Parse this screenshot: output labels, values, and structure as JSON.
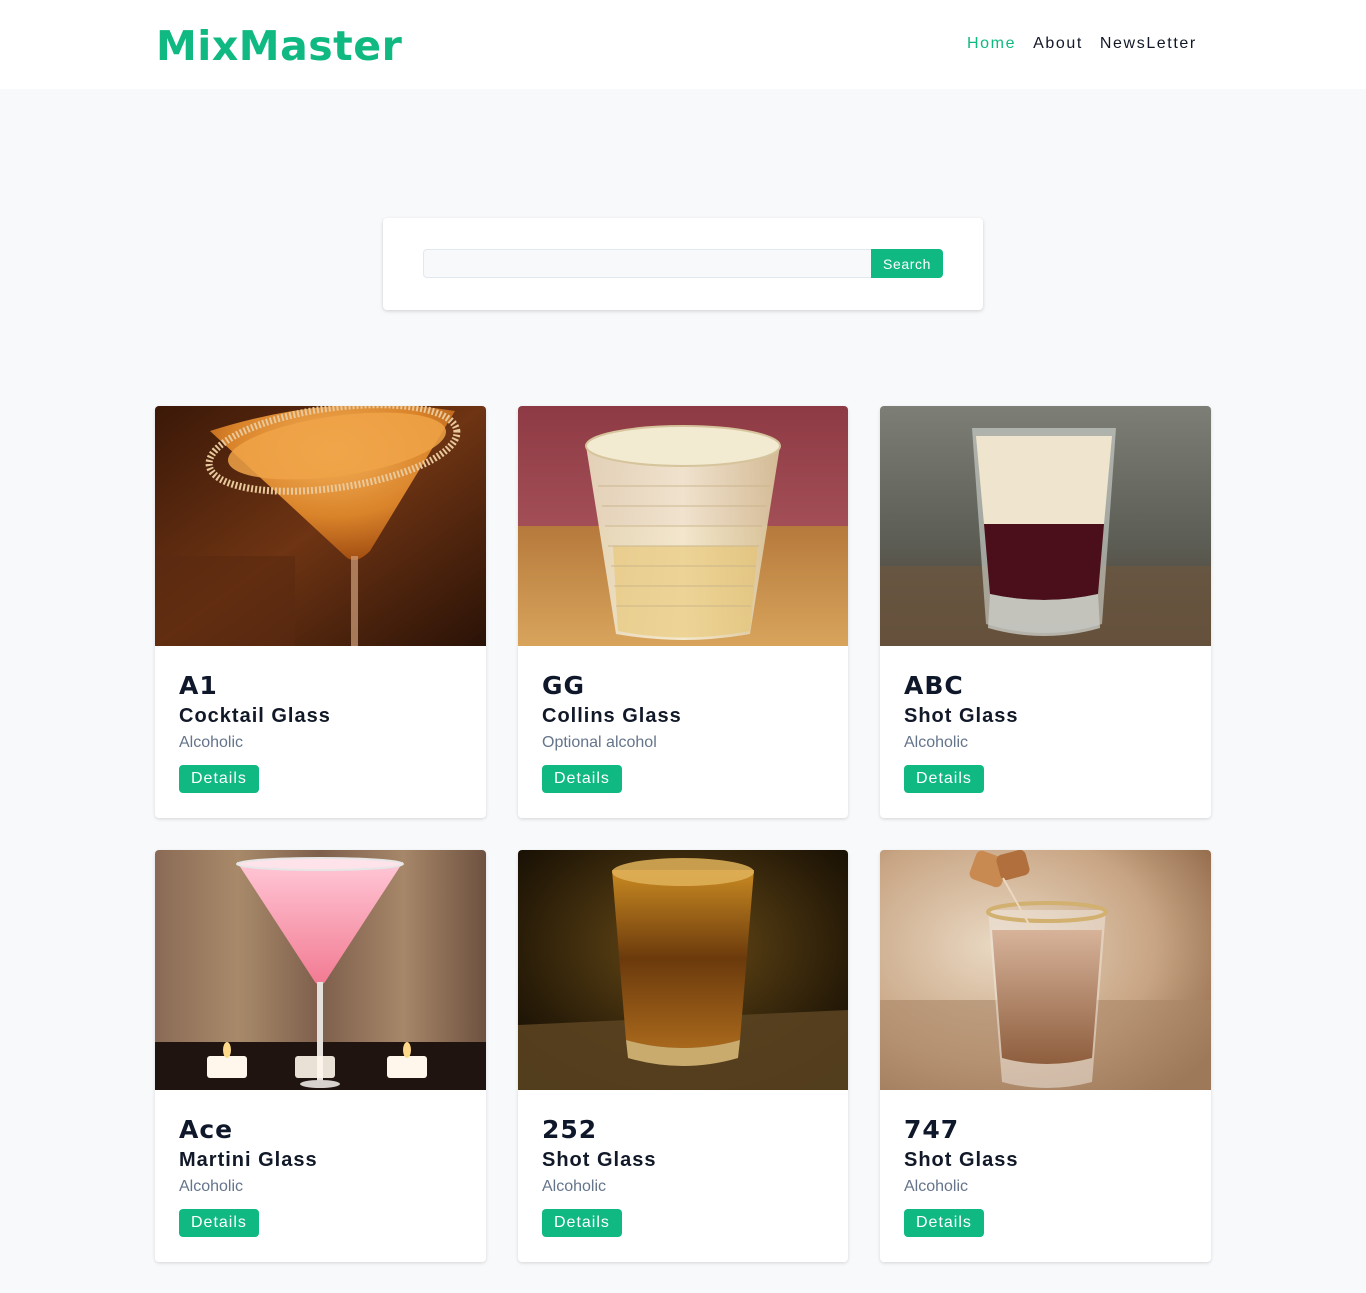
{
  "header": {
    "logo": "MixMaster",
    "nav": [
      {
        "label": "Home",
        "active": true
      },
      {
        "label": "About",
        "active": false
      },
      {
        "label": "NewsLetter",
        "active": false
      }
    ]
  },
  "search": {
    "value": "",
    "placeholder": "",
    "button_label": "Search"
  },
  "cocktails": [
    {
      "name": "A1",
      "glass": "Cocktail Glass",
      "info": "Alcoholic",
      "button": "Details",
      "image": "cocktail-glass-orange-drink"
    },
    {
      "name": "GG",
      "glass": "Collins Glass",
      "info": "Optional alcohol",
      "button": "Details",
      "image": "tumbler-glass-ice-drink"
    },
    {
      "name": "ABC",
      "glass": "Shot Glass",
      "info": "Alcoholic",
      "button": "Details",
      "image": "layered-shot-drink"
    },
    {
      "name": "Ace",
      "glass": "Martini Glass",
      "info": "Alcoholic",
      "button": "Details",
      "image": "pink-martini-drink"
    },
    {
      "name": "252",
      "glass": "Shot Glass",
      "info": "Alcoholic",
      "button": "Details",
      "image": "whiskey-shot-drink"
    },
    {
      "name": "747",
      "glass": "Shot Glass",
      "info": "Alcoholic",
      "button": "Details",
      "image": "caramel-cream-shot-drink"
    }
  ],
  "colors": {
    "accent": "#10b981",
    "background": "#f8f9fb",
    "text": "#0f172a",
    "muted": "#64748b"
  }
}
